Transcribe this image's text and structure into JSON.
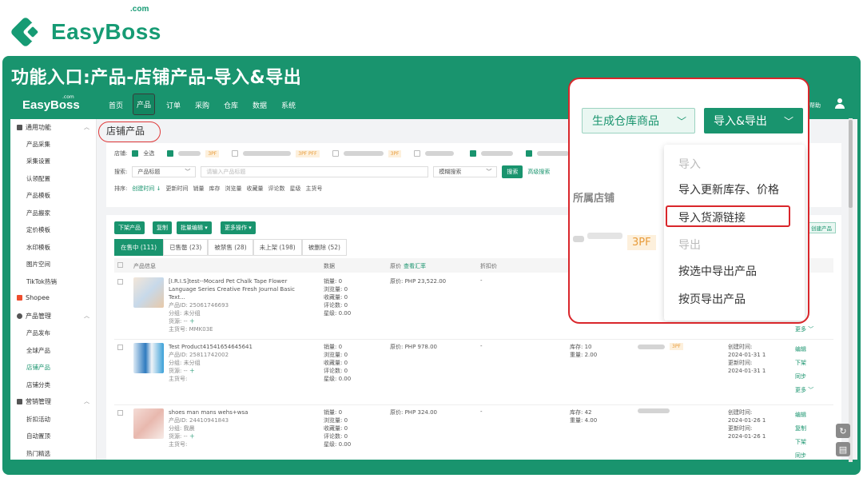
{
  "brand": {
    "name": "EasyBoss",
    "com": ".com"
  },
  "frame_title": "功能入口:产品-店铺产品-导入&导出",
  "topnav": {
    "brand": "EasyBoss",
    "brand_com": ".com",
    "items": [
      "首页",
      "产品",
      "订单",
      "采购",
      "仓库",
      "数据",
      "系统"
    ],
    "help": "帮助"
  },
  "sidebar": {
    "groups": [
      {
        "label": "通用功能",
        "items": [
          "产品采集",
          "采集设置",
          "认领配置",
          "产品模板",
          "产品搬家",
          "定价模板",
          "水印模板",
          "图片空间",
          "TikTok热销"
        ]
      },
      {
        "label": "Shopee",
        "items": []
      },
      {
        "label": "产品管理",
        "items": [
          "产品发布",
          "全球产品",
          "店铺产品",
          "店铺分类"
        ]
      },
      {
        "label": "营销管理",
        "items": [
          "折扣活动",
          "自动置顶",
          "热门精选"
        ]
      }
    ],
    "active_item": "店铺产品"
  },
  "page_title": "店铺产品",
  "filters": {
    "shop_label": "店铺:",
    "select_all": "全选",
    "shop_tags": [
      "3PF",
      "3PF PFF",
      "3PF"
    ],
    "search_label": "搜索:",
    "search_field": "产品标题",
    "search_placeholder": "请输入产品标题",
    "search_mode": "模糊搜索",
    "search_button": "搜索",
    "advanced_search": "高级搜索",
    "sort_label": "排序:",
    "sort_options": [
      "创建时间",
      "更新时间",
      "销量",
      "库存",
      "浏览量",
      "收藏量",
      "评论数",
      "星级",
      "主货号"
    ]
  },
  "toolbar": {
    "buttons": [
      "下架产品",
      "复制",
      "批量编辑",
      "更多操作"
    ]
  },
  "tabs": [
    "在售中 (111)",
    "已售罄 (23)",
    "被禁售 (28)",
    "未上架 (198)",
    "被删除 (52)"
  ],
  "table": {
    "headers": [
      "产品信息",
      "数据",
      "原价",
      "查看汇率",
      "折扣价"
    ],
    "rows": [
      {
        "title": "[I.R.I.S]test--Mocard Pet Chalk Tape Flower Language Series Creative Fresh Journal Basic Text...",
        "product_id": "产品ID: 25061746693",
        "group": "分组: 未分组",
        "source": "货源: --",
        "sku": "主货号: MMK03E",
        "stats": [
          "销量: 0",
          "浏览量: 0",
          "收藏量: 0",
          "评论数: 0",
          "星级: 0.00"
        ],
        "price": "原价: PHP 23,522.00",
        "discount": "-"
      },
      {
        "title": "Test Product41541654645641",
        "product_id": "产品ID: 25811742002",
        "group": "分组: 未分组",
        "source": "货源: --",
        "sku": "主货号:",
        "stats": [
          "销量: 0",
          "浏览量: 0",
          "收藏量: 0",
          "评论数: 0",
          "星级: 0.00"
        ],
        "price": "原价: PHP 978.00",
        "discount": "-",
        "inventory": [
          "库存: 10",
          "重量: 2.00"
        ],
        "shop_tag": "3PF",
        "times": [
          "创建时间:",
          "2024-01-31 1",
          "更新时间:",
          "2024-01-31 1"
        ],
        "ops": [
          "编辑",
          "下架",
          "同步",
          "更多"
        ]
      },
      {
        "title": "shoes man mans wehs+wsa",
        "product_id": "产品ID: 24410941843",
        "group": "分组: 我晨",
        "source": "货源: --",
        "sku": "主货号:",
        "stats": [
          "销量: 0",
          "浏览量: 0",
          "收藏量: 0",
          "评论数: 0",
          "星级: 0.00"
        ],
        "price": "原价: PHP 324.00",
        "discount": "-",
        "inventory": [
          "库存: 42",
          "重量: 4.00"
        ],
        "times": [
          "创建时间:",
          "2024-01-26 1",
          "更新时间:",
          "2024-01-26 1"
        ],
        "ops": [
          "编辑",
          "复制",
          "下架",
          "同步"
        ]
      }
    ]
  },
  "popup": {
    "button_generate": "生成仓库商品",
    "button_import_export": "导入&导出",
    "bg_label": "所属店铺",
    "bg_tag": "3PF",
    "menu": {
      "import_header": "导入",
      "import_update": "导入更新库存、价格",
      "import_source": "导入货源链接",
      "export_header": "导出",
      "export_selected": "按选中导出产品",
      "export_page": "按页导出产品"
    }
  },
  "side_links": {
    "create": "创建产品",
    "more": "更多"
  },
  "colors": {
    "brand_green": "#19946e",
    "highlight_red": "#d9262b",
    "tag_orange": "#e89b3a"
  }
}
